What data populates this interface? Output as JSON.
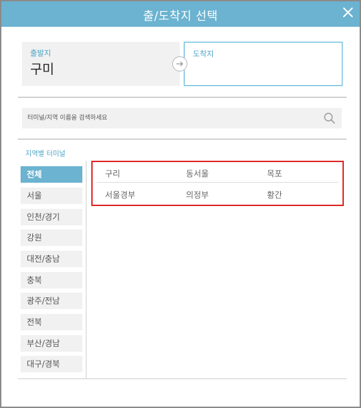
{
  "dialog": {
    "title": "출/도착지 선택"
  },
  "route": {
    "origin_label": "출발지",
    "origin_value": "구미",
    "destination_label": "도착지"
  },
  "search": {
    "placeholder": "터미널/지역 이름을 검색하세요"
  },
  "regions": {
    "title": "지역별 터미널",
    "items": [
      {
        "label": "전체",
        "active": true
      },
      {
        "label": "서울"
      },
      {
        "label": "인천/경기"
      },
      {
        "label": "강원"
      },
      {
        "label": "대전/충남"
      },
      {
        "label": "충북"
      },
      {
        "label": "광주/전남"
      },
      {
        "label": "전북"
      },
      {
        "label": "부산/경남"
      },
      {
        "label": "대구/경북"
      }
    ]
  },
  "terminals": {
    "rows": [
      [
        "구리",
        "동서울",
        "목포"
      ],
      [
        "서울경부",
        "의정부",
        "황간"
      ]
    ]
  },
  "colors": {
    "accent": "#6bb3d0",
    "label_blue": "#4aa3c5",
    "highlight_border": "#e02424"
  },
  "icons": {
    "close": "close-icon",
    "swap": "arrow-right-icon",
    "search": "search-icon"
  }
}
